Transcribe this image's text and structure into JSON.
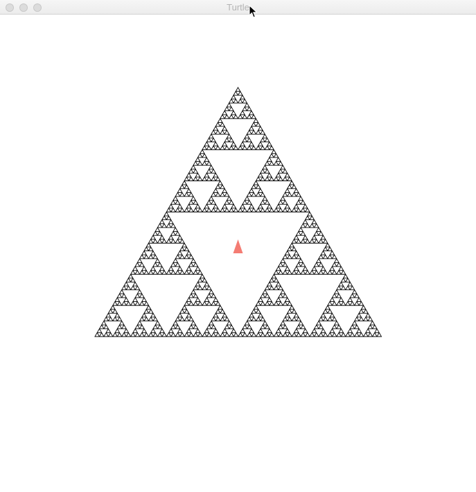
{
  "window": {
    "title": "Turtle"
  },
  "drawing": {
    "line_color": "#000000",
    "turtle_color": "#f47c73",
    "background": "#ffffff"
  },
  "icons": {
    "cursor": "arrow-cursor-icon",
    "turtle": "turtle-arrow-icon"
  }
}
